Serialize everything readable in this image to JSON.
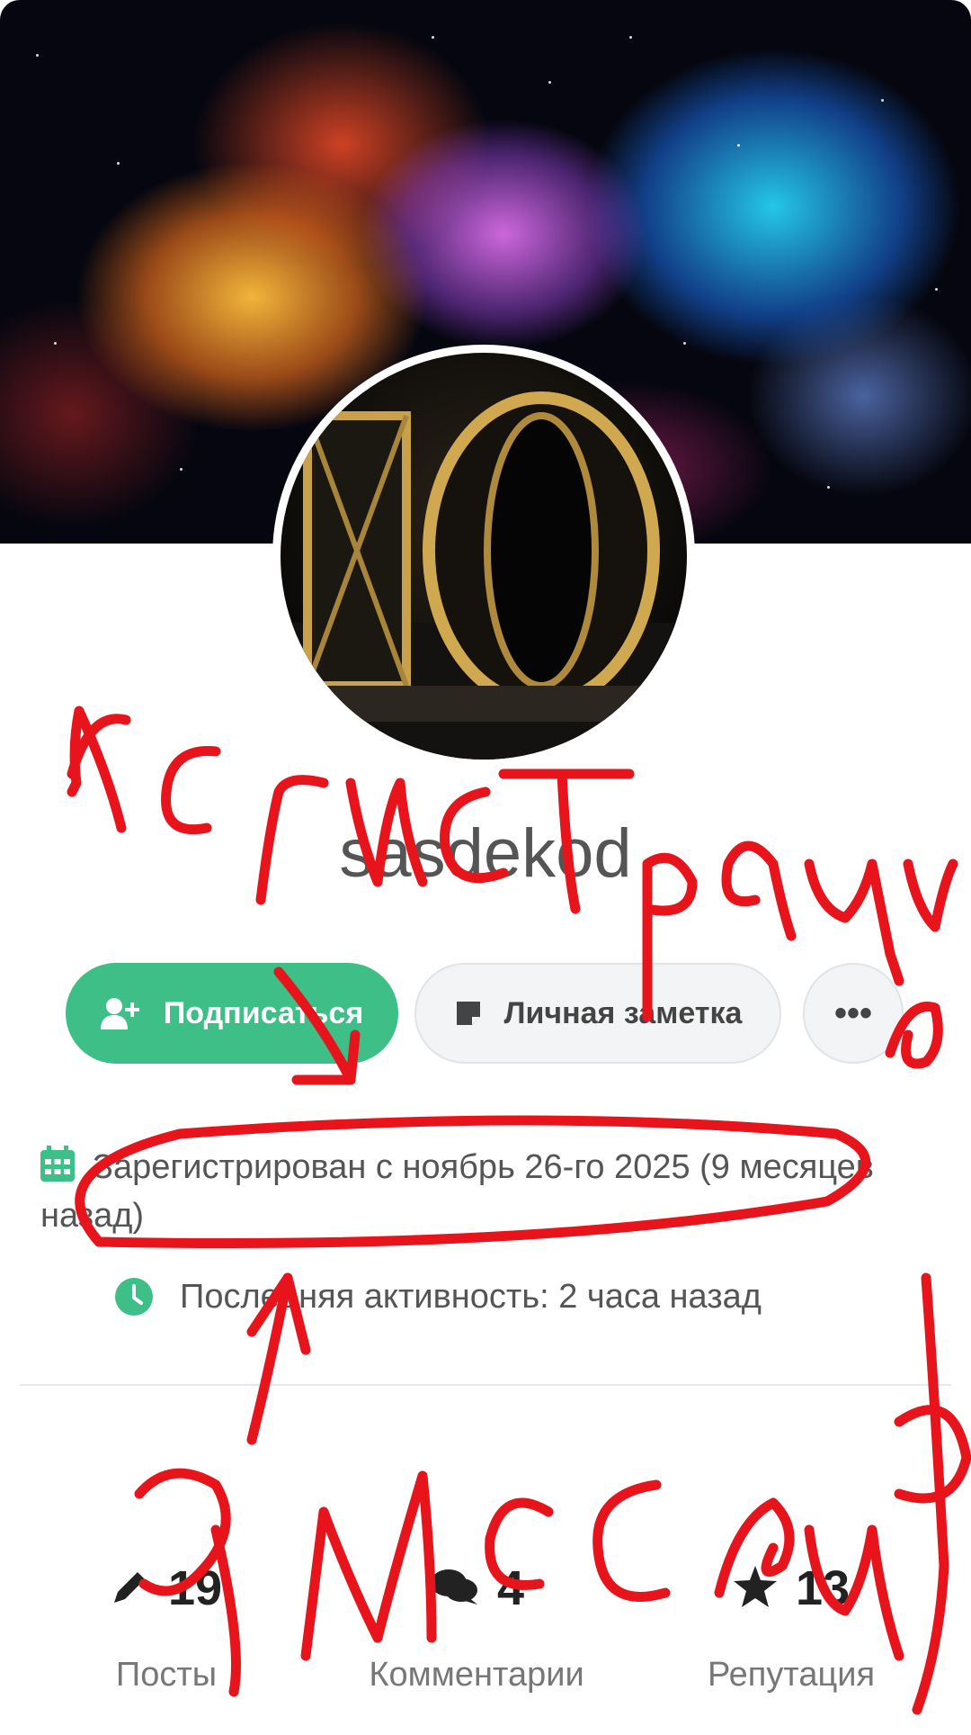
{
  "profile": {
    "display_name": "sasdekod",
    "avatar_text": "10"
  },
  "actions": {
    "follow_label": "Подписаться",
    "note_label": "Личная заметка",
    "more_label": "•••"
  },
  "meta": {
    "registered": "Зарегистрирован с ноябрь 26-го 2025 (9 месяцев назад)",
    "last_active": "Последняя активность: 2 часа назад"
  },
  "stats": [
    {
      "icon": "pencil-icon",
      "value": "19",
      "label": "Посты"
    },
    {
      "icon": "comments-icon",
      "value": "4",
      "label": "Комментарии"
    },
    {
      "icon": "star-icon",
      "value": "13",
      "label": "Репутация"
    }
  ],
  "colors": {
    "accent": "#3dbf87",
    "annotation": "#e8141c"
  },
  "annotations": {
    "top": "регистрация",
    "bottom": "9 месяцев"
  }
}
